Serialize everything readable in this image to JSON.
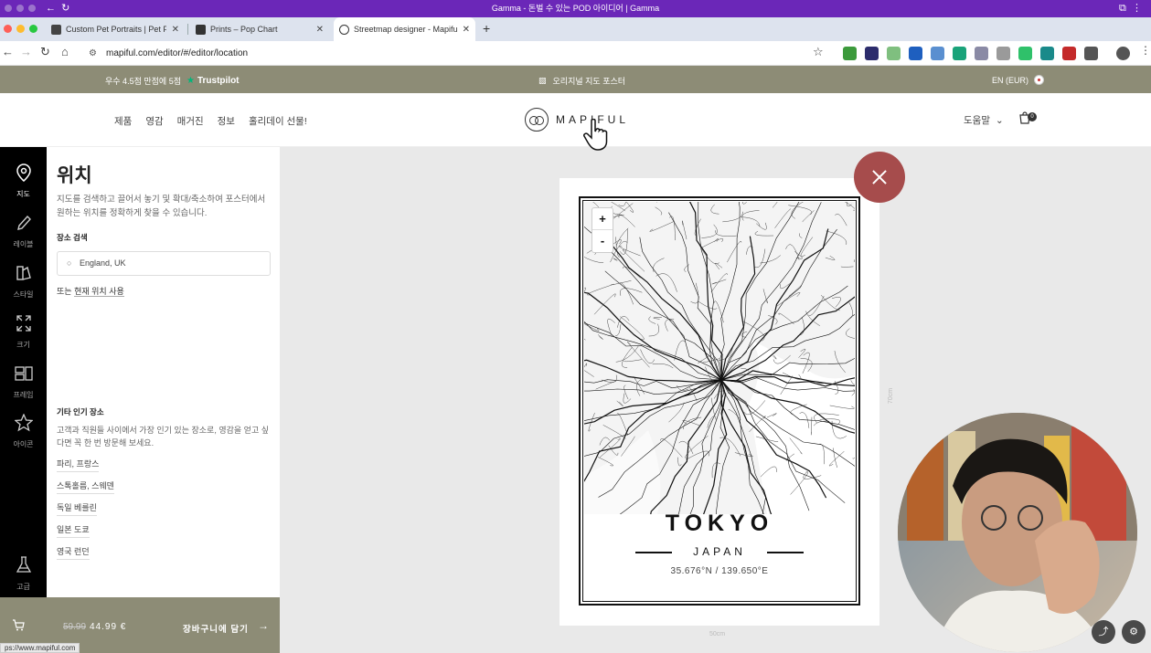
{
  "window": {
    "title": "Gamma - 돈벌 수 있는 POD 아이디어 | Gamma"
  },
  "tabs": [
    {
      "label": "Custom Pet Portraits | Pet Pi",
      "favicon_color": "#444"
    },
    {
      "label": "Prints – Pop Chart",
      "favicon_color": "#333"
    },
    {
      "label": "Streetmap designer - Mapiful",
      "favicon_color": "#fff"
    }
  ],
  "address_bar": {
    "url": "mapiful.com/editor/#/editor/location"
  },
  "promo_bar": {
    "rating_text": "우수 4.5점 만점에 5점",
    "trustpilot_label": "Trustpilot",
    "center_text": "오리지널 지도 포스터",
    "currency_label": "EN (EUR)"
  },
  "site_nav": {
    "items": [
      "제품",
      "영감",
      "매거진",
      "정보",
      "홀리데이 선물!"
    ],
    "logo_text": "MAPIFUL",
    "help_label": "도움말",
    "cart_count": "0"
  },
  "icon_rail": [
    {
      "label": "지도",
      "icon": "map-pin-icon",
      "active": true
    },
    {
      "label": "레이블",
      "icon": "pencil-icon",
      "active": false
    },
    {
      "label": "스타일",
      "icon": "palette-icon",
      "active": false
    },
    {
      "label": "크기",
      "icon": "expand-icon",
      "active": false
    },
    {
      "label": "프레임",
      "icon": "frame-icon",
      "active": false
    },
    {
      "label": "아이콘",
      "icon": "star-icon",
      "active": false
    },
    {
      "label": "고급",
      "icon": "flask-icon",
      "active": false
    }
  ],
  "panel": {
    "title": "위치",
    "description": "지도를 검색하고 끌어서 놓기 및 확대/축소하여 포스터에서 원하는 위치를 정확하게 찾을 수 있습니다.",
    "search_label": "장소 검색",
    "search_value": "England, UK",
    "or_text": "또는",
    "current_location_label": "현재 위치 사용",
    "popular_title": "기타 인기 장소",
    "popular_description": "고객과 직원들 사이에서 가장 인기 있는 장소로, 영감을 얻고 싶다면 꼭 한 번 방문해 보세요.",
    "popular_places": [
      "파리, 프랑스",
      "스톡홀름, 스웨덴",
      "독일 베를린",
      "일본 도쿄",
      "영국 런던"
    ]
  },
  "cart_bar": {
    "old_price": "59.99",
    "price": "44.99 €",
    "add_label": "장바구니에 담기"
  },
  "status_url": "ps://www.mapiful.com",
  "poster": {
    "city": "TOKYO",
    "country": "JAPAN",
    "coordinates": "35.676°N / 139.650°E",
    "width_label": "50cm",
    "height_label": "70cm",
    "zoom_in": "+",
    "zoom_out": "-"
  },
  "colors": {
    "brand_olive": "#8d8c76",
    "title_bar": "#6b27b8",
    "close_button": "#a64c4c"
  }
}
